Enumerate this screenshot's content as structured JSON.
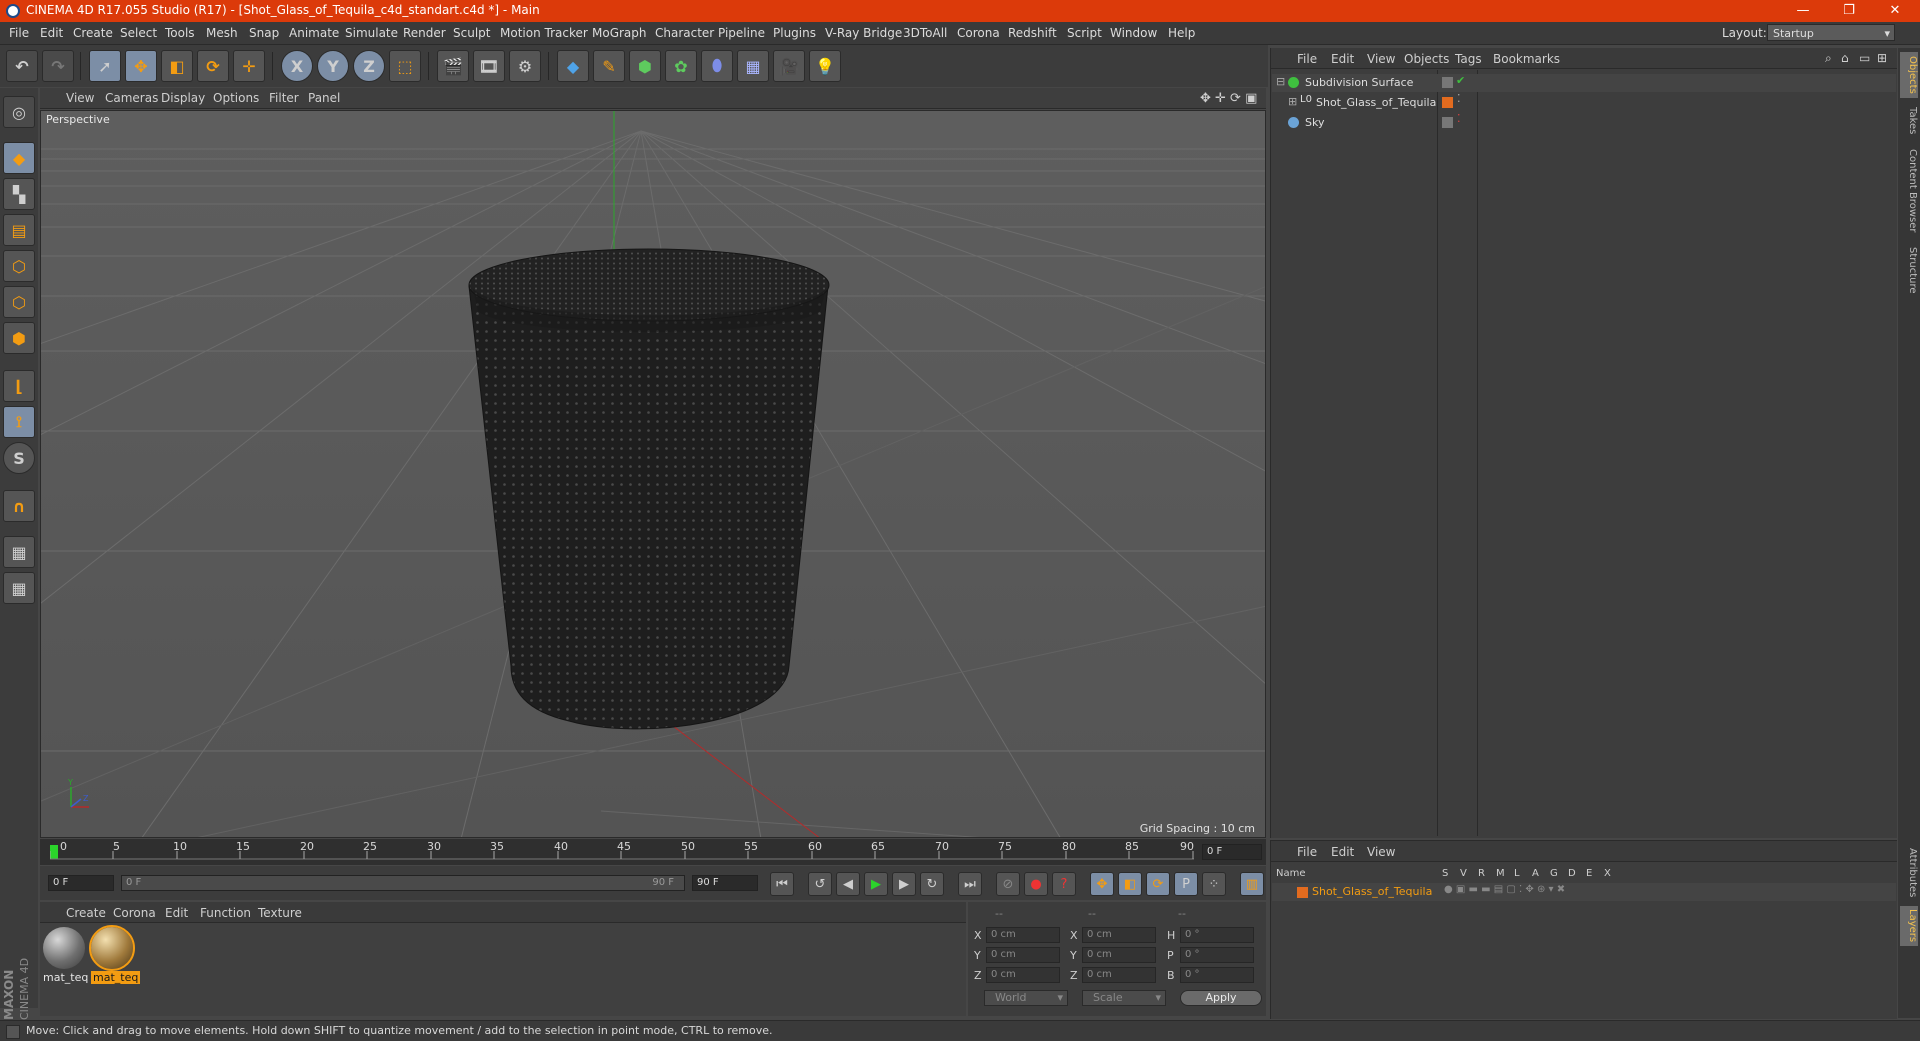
{
  "window": {
    "title": "CINEMA 4D R17.055 Studio (R17) - [Shot_Glass_of_Tequila_c4d_standart.c4d *] - Main"
  },
  "menu": [
    "File",
    "Edit",
    "Create",
    "Select",
    "Tools",
    "Mesh",
    "Snap",
    "Animate",
    "Simulate",
    "Render",
    "Sculpt",
    "Motion Tracker",
    "MoGraph",
    "Character",
    "Pipeline",
    "Plugins",
    "V-Ray Bridge",
    "3DToAll",
    "Corona",
    "Redshift",
    "Script",
    "Window",
    "Help"
  ],
  "layout": {
    "label": "Layout:",
    "value": "Startup"
  },
  "toolbar": {
    "x_label": "X",
    "y_label": "Y",
    "z_label": "Z"
  },
  "viewport": {
    "menu": [
      "View",
      "Cameras",
      "Display",
      "Options",
      "Filter",
      "Panel"
    ],
    "label": "Perspective",
    "grid_spacing": "Grid Spacing : 10 cm"
  },
  "timeline": {
    "ticks": [
      "0",
      "5",
      "10",
      "15",
      "20",
      "25",
      "30",
      "35",
      "40",
      "45",
      "50",
      "55",
      "60",
      "65",
      "70",
      "75",
      "80",
      "85",
      "90"
    ],
    "current_frame": "0 F",
    "start_field": "0 F",
    "range_start": "0 F",
    "range_end": "90 F",
    "end_field": "90 F"
  },
  "material_manager": {
    "menu": [
      "Create",
      "Corona",
      "Edit",
      "Function",
      "Texture"
    ],
    "materials": [
      {
        "name": "mat_teq"
      },
      {
        "name": "mat_teq"
      }
    ]
  },
  "coordinates": {
    "header": [
      "--",
      "--",
      "--"
    ],
    "rows": [
      {
        "a": "X",
        "av": "0 cm",
        "b": "X",
        "bv": "0 cm",
        "c": "H",
        "cv": "0 °"
      },
      {
        "a": "Y",
        "av": "0 cm",
        "b": "Y",
        "bv": "0 cm",
        "c": "P",
        "cv": "0 °"
      },
      {
        "a": "Z",
        "av": "0 cm",
        "b": "Z",
        "bv": "0 cm",
        "c": "B",
        "cv": "0 °"
      }
    ],
    "space": "World",
    "mode": "Scale",
    "apply": "Apply"
  },
  "object_manager": {
    "menu": [
      "File",
      "Edit",
      "View",
      "Objects",
      "Tags",
      "Bookmarks"
    ],
    "objects": [
      "Subdivision Surface",
      "Shot_Glass_of_Tequila",
      "Sky"
    ]
  },
  "layer_manager": {
    "menu": [
      "File",
      "Edit",
      "View"
    ],
    "columns": [
      "Name",
      "S",
      "V",
      "R",
      "M",
      "L",
      "A",
      "G",
      "D",
      "E",
      "X"
    ],
    "layer": "Shot_Glass_of_Tequila"
  },
  "right_tabs": [
    "Objects",
    "Takes",
    "Content Browser",
    "Structure",
    "Attributes",
    "Layers"
  ],
  "logo": {
    "brand": "MAXON",
    "product": "CINEMA 4D"
  },
  "status": "Move: Click and drag to move elements. Hold down SHIFT to quantize movement / add to the selection in point mode, CTRL to remove.",
  "colors": {
    "titlebar": "#dc3a0a",
    "accent": "#f39c12",
    "selected": "#7c8ea6"
  }
}
